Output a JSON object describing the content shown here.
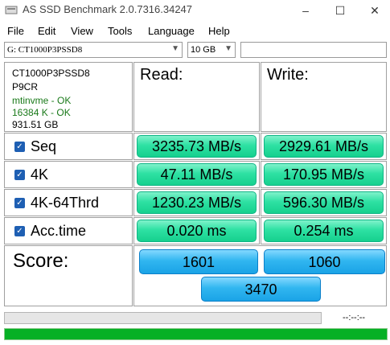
{
  "window": {
    "title": "AS SSD Benchmark 2.0.7316.34247",
    "controls": [
      "–",
      "☐",
      "✕"
    ]
  },
  "menu": [
    "File",
    "Edit",
    "View",
    "Tools",
    "Language",
    "Help"
  ],
  "toolbar": {
    "drive_value": "G: CT1000P3PSSD8",
    "size_value": "10 GB"
  },
  "info": {
    "model": "CT1000P3PSSD8",
    "firmware": "P9CR",
    "driver": "mtinvme - OK",
    "alignment": "16384 K - OK",
    "capacity": "931.51 GB"
  },
  "headers": {
    "read": "Read:",
    "write": "Write:"
  },
  "tests": [
    {
      "label": "Seq",
      "read": "3235.73 MB/s",
      "write": "2929.61 MB/s",
      "checked": true
    },
    {
      "label": "4K",
      "read": "47.11 MB/s",
      "write": "170.95 MB/s",
      "checked": true
    },
    {
      "label": "4K-64Thrd",
      "read": "1230.23 MB/s",
      "write": "596.30 MB/s",
      "checked": true
    },
    {
      "label": "Acc.time",
      "read": "0.020 ms",
      "write": "0.254 ms",
      "checked": true
    }
  ],
  "score": {
    "label": "Score:",
    "read": "1601",
    "write": "1060",
    "total": "3470"
  },
  "status": {
    "time": "--:--:--",
    "progress": 1.0
  },
  "colors": {
    "result_green": "#2ee1a3",
    "score_blue": "#31b6f0",
    "progress_green": "#06b025",
    "ok_text": "#1a7a1a",
    "checkbox_blue": "#1e5fb3"
  }
}
